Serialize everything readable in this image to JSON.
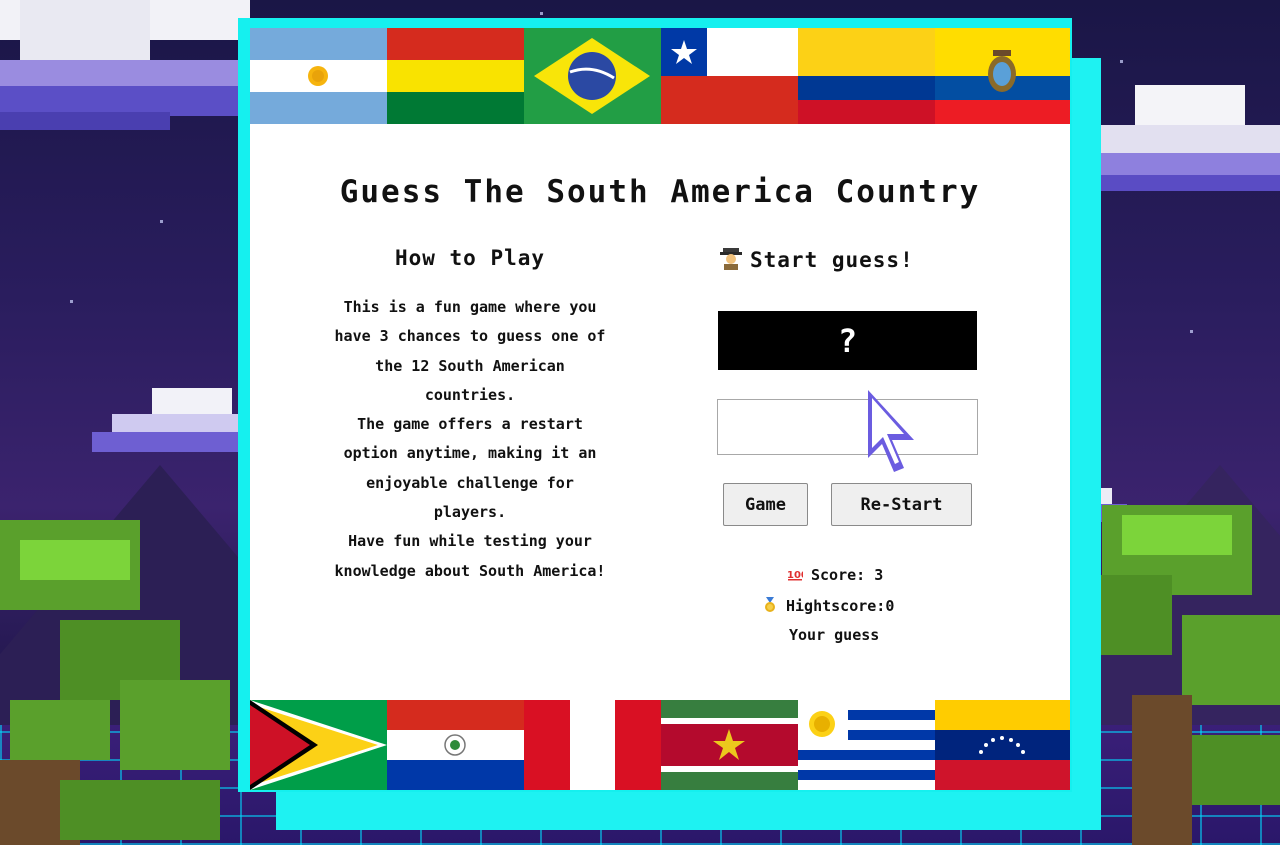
{
  "game": {
    "title": "Guess The South America Country",
    "how_to_play": {
      "heading": "How to Play",
      "lines": [
        "This is a fun game where you",
        "have 3 chances to guess one of",
        "the 12 South American",
        "countries.",
        "The game offers a restart",
        "option anytime, making it an",
        "enjoyable challenge for",
        "players.",
        "Have fun while testing your",
        "knowledge about South America!"
      ]
    },
    "start_label": "Start guess!",
    "secret_placeholder": "?",
    "guess_input_value": "",
    "buttons": {
      "game": "Game",
      "restart": "Re-Start"
    },
    "score_label": "Score: 3",
    "highscore_label": "Hightscore:0",
    "your_guess_label": "Your guess",
    "icons": {
      "start": "detective-icon",
      "score": "hundred-points-icon",
      "highscore": "medal-icon",
      "cursor": "pointer-cursor-icon"
    }
  },
  "flags_top": [
    "argentina-flag",
    "bolivia-flag",
    "brazil-flag",
    "chile-flag",
    "colombia-flag",
    "ecuador-flag"
  ],
  "flags_bottom": [
    "guyana-flag",
    "paraguay-flag",
    "peru-flag",
    "suriname-flag",
    "uruguay-flag",
    "venezuela-flag"
  ],
  "colors": {
    "frame": "#15f0ef",
    "card": "#ffffff",
    "secret_box": "#000000"
  }
}
